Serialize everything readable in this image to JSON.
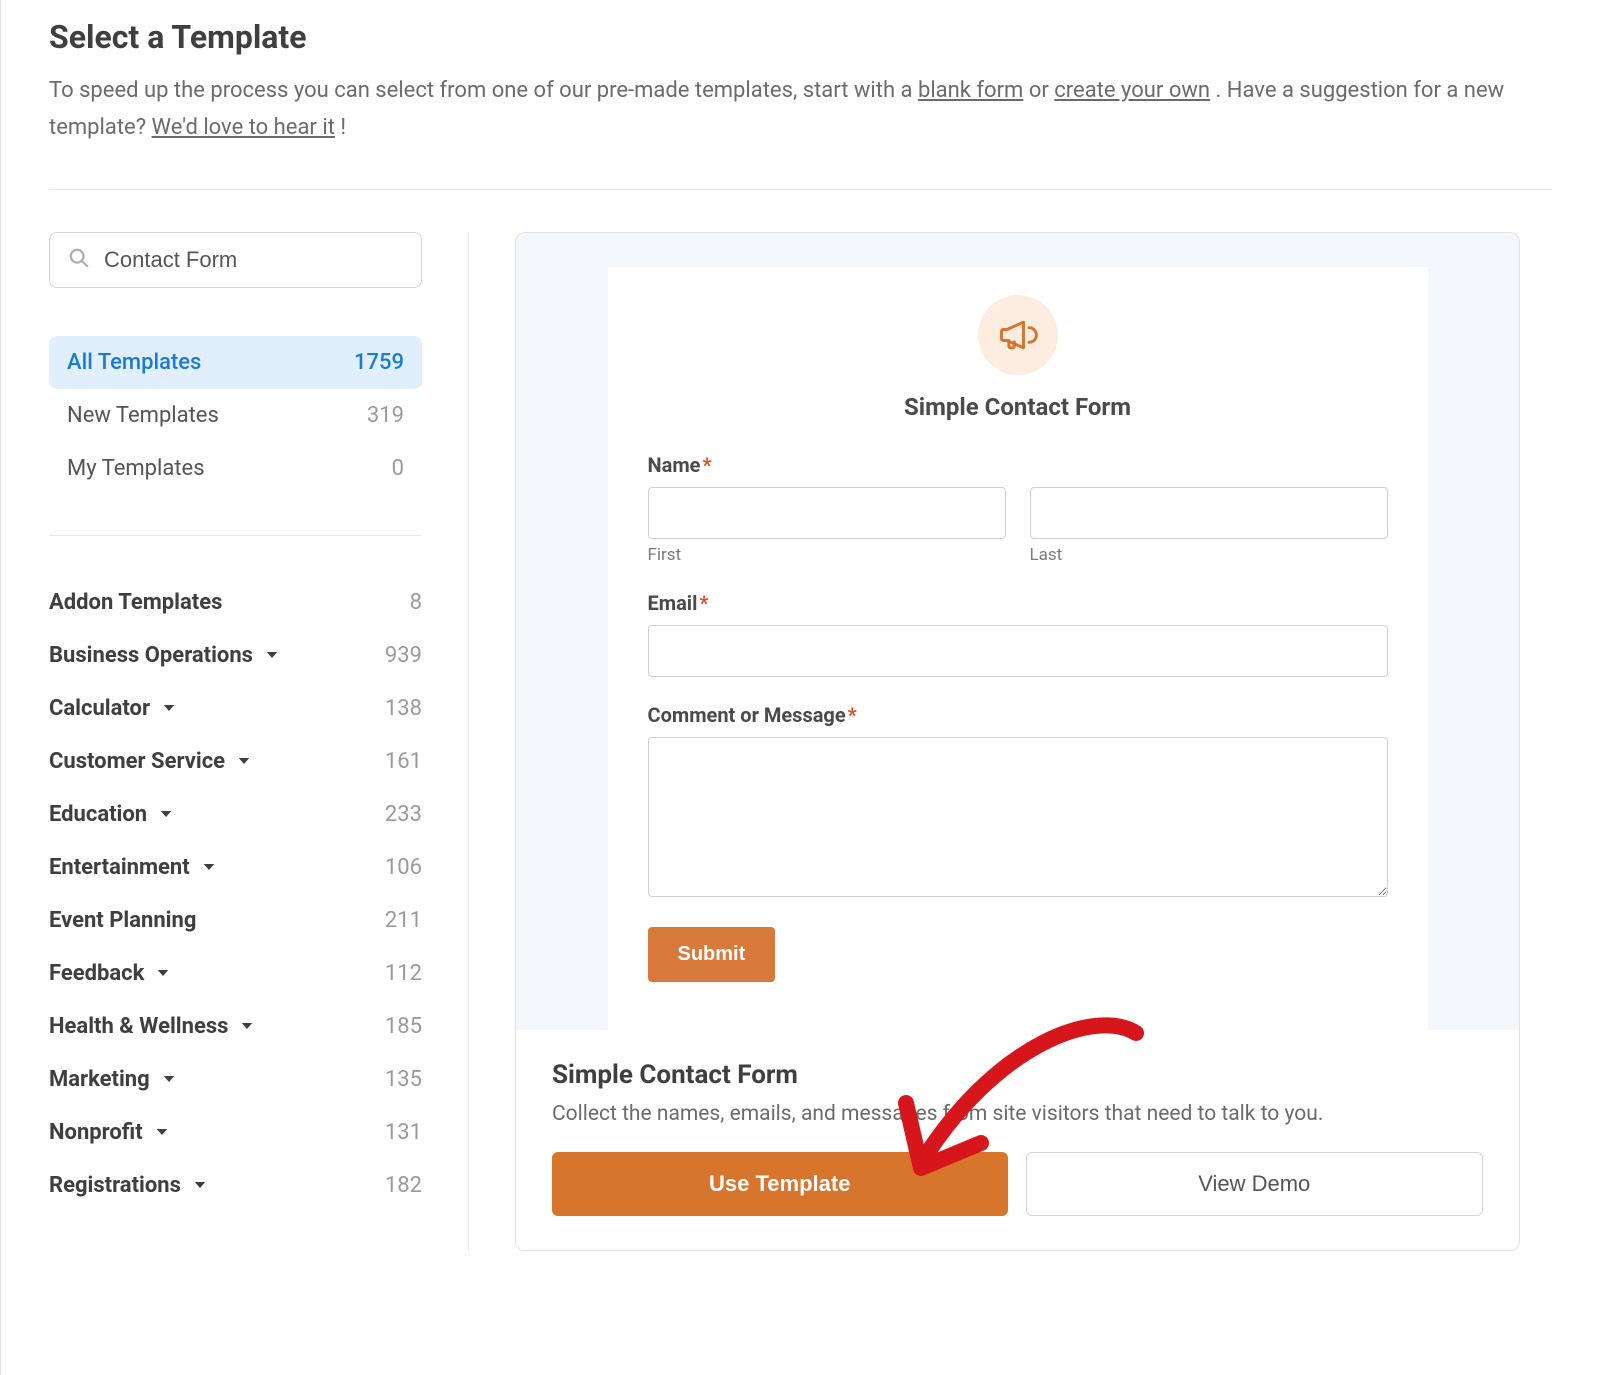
{
  "header": {
    "title": "Select a Template",
    "intro_prefix": "To speed up the process you can select from one of our pre-made templates, start with a ",
    "blank_link": "blank form",
    "intro_mid": " or ",
    "create_link": "create your own",
    "intro_suffix": ". Have a suggestion for a new template? ",
    "hear_link": "We'd love to hear it",
    "intro_end": "!"
  },
  "search": {
    "value": "Contact Form"
  },
  "template_groups": [
    {
      "label": "All Templates",
      "count": "1759",
      "active": true
    },
    {
      "label": "New Templates",
      "count": "319",
      "active": false
    },
    {
      "label": "My Templates",
      "count": "0",
      "active": false
    }
  ],
  "categories": [
    {
      "label": "Addon Templates",
      "count": "8",
      "chevron": false
    },
    {
      "label": "Business Operations",
      "count": "939",
      "chevron": true
    },
    {
      "label": "Calculator",
      "count": "138",
      "chevron": true
    },
    {
      "label": "Customer Service",
      "count": "161",
      "chevron": true
    },
    {
      "label": "Education",
      "count": "233",
      "chevron": true
    },
    {
      "label": "Entertainment",
      "count": "106",
      "chevron": true
    },
    {
      "label": "Event Planning",
      "count": "211",
      "chevron": false
    },
    {
      "label": "Feedback",
      "count": "112",
      "chevron": true
    },
    {
      "label": "Health & Wellness",
      "count": "185",
      "chevron": true
    },
    {
      "label": "Marketing",
      "count": "135",
      "chevron": true
    },
    {
      "label": "Nonprofit",
      "count": "131",
      "chevron": true
    },
    {
      "label": "Registrations",
      "count": "182",
      "chevron": true
    }
  ],
  "preview": {
    "form_title": "Simple Contact Form",
    "name_label": "Name",
    "first_label": "First",
    "last_label": "Last",
    "email_label": "Email",
    "comment_label": "Comment or Message",
    "submit_label": "Submit"
  },
  "card": {
    "title": "Simple Contact Form",
    "desc": "Collect the names, emails, and messages from site visitors that need to talk to you.",
    "use_btn": "Use Template",
    "demo_btn": "View Demo"
  },
  "colors": {
    "accent": "#d7752c",
    "active_bg": "#e1effc",
    "active_fg": "#1a7bd4"
  }
}
